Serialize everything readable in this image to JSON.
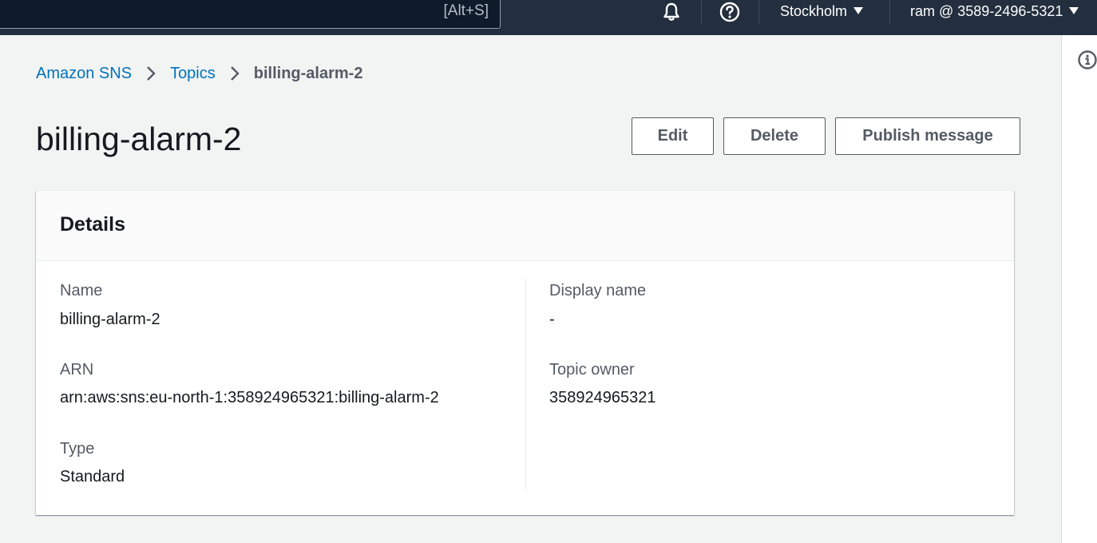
{
  "topnav": {
    "search_shortcut": "[Alt+S]",
    "region": "Stockholm",
    "account": "ram @ 3589-2496-5321"
  },
  "breadcrumb": {
    "items": [
      "Amazon SNS",
      "Topics"
    ],
    "current": "billing-alarm-2"
  },
  "page": {
    "title": "billing-alarm-2"
  },
  "actions": {
    "edit": "Edit",
    "delete": "Delete",
    "publish": "Publish message"
  },
  "details": {
    "title": "Details",
    "name_label": "Name",
    "name_value": "billing-alarm-2",
    "arn_label": "ARN",
    "arn_value": "arn:aws:sns:eu-north-1:358924965321:billing-alarm-2",
    "type_label": "Type",
    "type_value": "Standard",
    "display_name_label": "Display name",
    "display_name_value": "-",
    "owner_label": "Topic owner",
    "owner_value": "358924965321"
  },
  "colors": {
    "nav_bg": "#232f3e",
    "link": "#0073bb",
    "page_bg": "#f2f3f3"
  },
  "icons": [
    "bell-icon",
    "help-icon",
    "info-icon",
    "chevron-right-icon",
    "caret-down-icon"
  ]
}
